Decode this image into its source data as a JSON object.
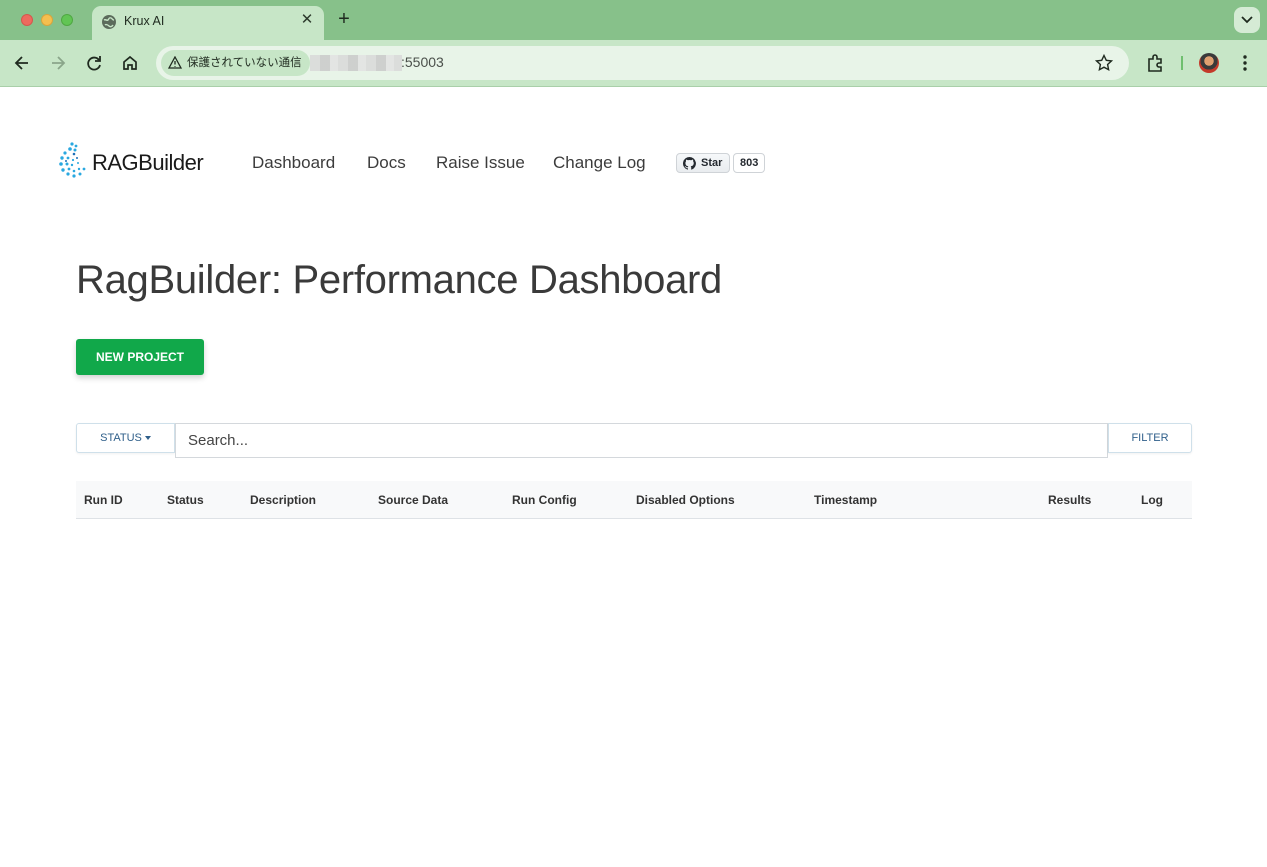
{
  "browser": {
    "tab_title": "Krux AI",
    "new_tab_icon": "plus-icon",
    "security_label": "保護されていない通信",
    "url_port": ":55003"
  },
  "nav": {
    "logo_text": "RAGBuilder",
    "links": [
      "Dashboard",
      "Docs",
      "Raise Issue",
      "Change Log"
    ],
    "github_star_label": "Star",
    "github_star_count": "803"
  },
  "main": {
    "title": "RagBuilder: Performance Dashboard",
    "new_project_label": "NEW PROJECT",
    "status_label": "STATUS",
    "search_placeholder": "Search...",
    "filter_label": "FILTER"
  },
  "table": {
    "columns": [
      "Run ID",
      "Status",
      "Description",
      "Source Data",
      "Run Config",
      "Disabled Options",
      "Timestamp",
      "Results",
      "Log"
    ],
    "rows": []
  },
  "colors": {
    "accent": "#11a84a",
    "chrome": "#87c18a",
    "link_button_text": "#2f5f8a"
  }
}
